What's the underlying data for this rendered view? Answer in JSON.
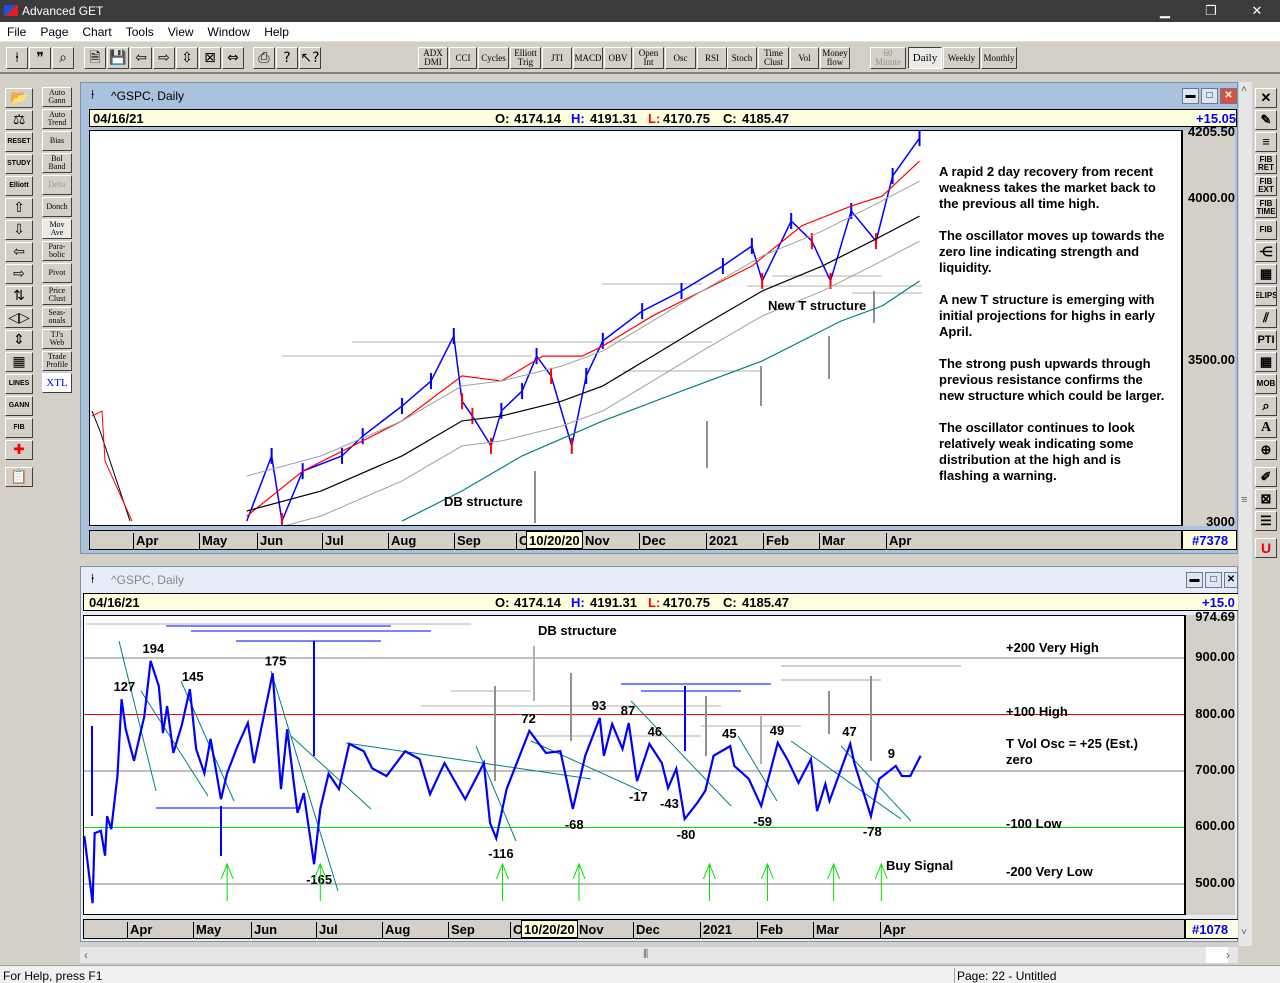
{
  "app": {
    "title": "Advanced GET",
    "minimize": "▁",
    "restore": "❐",
    "close": "✕"
  },
  "menu": [
    "File",
    "Page",
    "Chart",
    "Tools",
    "View",
    "Window",
    "Help"
  ],
  "toolbar": {
    "icons": [
      "cursor-icon",
      "quote-icon",
      "zoom-icon",
      "new-page-icon",
      "save-icon",
      "scroll-left-icon",
      "scroll-right-icon",
      "expand-icon",
      "compress-icon",
      "link-icon",
      "print-icon",
      "help-icon",
      "context-help-icon"
    ],
    "studies": [
      "ADX DMI",
      "CCI",
      "Cycles",
      "Elliott Trig",
      "JTI",
      "MACD",
      "OBV",
      "Open Int",
      "Osc",
      "RSI",
      "Stoch",
      "Time Clust",
      "Vol",
      "Money flow"
    ],
    "timeframes": [
      {
        "label": "60 Minute",
        "state": "disabled"
      },
      {
        "label": "Daily",
        "state": "active"
      },
      {
        "label": "Weekly",
        "state": "normal"
      },
      {
        "label": "Monthly",
        "state": "normal"
      }
    ]
  },
  "left_tools_a": [
    "open",
    "bias-scale",
    "RESET",
    "STUDY",
    "Elliott",
    "up",
    "down",
    "left",
    "right",
    "split",
    "expand",
    "contract",
    "grid",
    "LINES",
    "GANN",
    "FIB",
    "crosshair",
    "notes"
  ],
  "left_tools_b": [
    {
      "label": "Auto Gann"
    },
    {
      "label": "Auto Trend"
    },
    {
      "label": "Bias"
    },
    {
      "label": "Bol Band"
    },
    {
      "label": "Delta",
      "disabled": true
    },
    {
      "label": "Donch"
    },
    {
      "label": "Mov Ave",
      "active": true
    },
    {
      "label": "Para-bolic"
    },
    {
      "label": "Pivot"
    },
    {
      "label": "Price Clust"
    },
    {
      "label": "Seas-onals"
    },
    {
      "label": "TJ's Web"
    },
    {
      "label": "Trade Profile"
    },
    {
      "label": "XTL"
    }
  ],
  "right_tools": [
    "FIB RET",
    "FIB EXT",
    "FIB TIME",
    "FIB",
    "ELIPS",
    "PTI",
    "MOB",
    "A"
  ],
  "chart1": {
    "title": "^GSPC, Daily",
    "date": "04/16/21",
    "o_label": "O:",
    "o": "4174.14",
    "h_label": "H:",
    "h": "4191.31",
    "l_label": "L:",
    "l": "4170.75",
    "c_label": "C:",
    "c": "4185.47",
    "change": "+15.05",
    "bar_count": "#7378",
    "y_top": "4205.50",
    "y_ticks": [
      "4000.00",
      "3500.00",
      "3000"
    ],
    "annotations": {
      "new_t": "New T structure",
      "db": "DB structure"
    },
    "commentary": [
      "A rapid 2 day recovery from recent weakness takes the market back to the previous all time high.",
      "The oscillator moves up towards the zero line indicating strength and liquidity.",
      "A new T structure is emerging with initial projections for highs in early April.",
      "The strong push upwards through previous resistance confirms the new structure which could be larger.",
      "The oscillator continues to look relatively weak indicating some distribution at the high and is flashing a warning."
    ]
  },
  "chart2": {
    "title": "^GSPC, Daily",
    "date": "04/16/21",
    "o_label": "O:",
    "o": "4174.14",
    "h_label": "H:",
    "h": "4191.31",
    "l_label": "L:",
    "l": "4170.75",
    "c_label": "C:",
    "c": "4185.47",
    "change": "+15.0",
    "bar_count": "#1078",
    "y_top": "974.69",
    "y_ticks": [
      "900.00",
      "800.00",
      "700.00",
      "600.00",
      "500.00"
    ],
    "levels": [
      "+200 Very High",
      "+100 High",
      "T Vol Osc = +25 (Est.)",
      "zero",
      "-100 Low",
      "-200 Very Low"
    ],
    "db": "DB structure",
    "buy_signal": "Buy Signal"
  },
  "xaxis": {
    "months": [
      "Apr",
      "May",
      "Jun",
      "Jul",
      "Aug",
      "Sep",
      "O",
      "Nov",
      "Dec",
      "2021",
      "Feb",
      "Mar",
      "Apr"
    ],
    "cursor_date": "10/20/20"
  },
  "status": {
    "help": "For Help, press F1",
    "page": "Page: 22 - Untitled"
  },
  "colors": {
    "osc": "#0000ff",
    "high": "#ff0000",
    "low": "#00e000",
    "ma_fast": "#ff0000",
    "ma_slow": "#000000",
    "band": "#a0a0a0",
    "trend": "#008080"
  },
  "chart_data": [
    {
      "type": "line",
      "title": "^GSPC, Daily",
      "x_unit": "days since 2020-03-01",
      "ylim": [
        2950,
        4205.5
      ],
      "series": [
        {
          "name": "price",
          "x": [
            85,
            97,
            102,
            112,
            131,
            141,
            160,
            174,
            185,
            189,
            194,
            203,
            208,
            218,
            225,
            232,
            242,
            249,
            257,
            276,
            295,
            315,
            329,
            334,
            348,
            358,
            367,
            377,
            389,
            397,
            410
          ],
          "values": [
            3003,
            3204,
            3003,
            3157,
            3204,
            3265,
            3358,
            3435,
            3574,
            3373,
            3327,
            3235,
            3343,
            3404,
            3512,
            3451,
            3235,
            3451,
            3559,
            3651,
            3713,
            3790,
            3852,
            3744,
            3929,
            3867,
            3744,
            3960,
            3867,
            4068,
            4185
          ]
        },
        {
          "name": "ma-red",
          "x": [
            85,
            112,
            160,
            189,
            208,
            228,
            247,
            257,
            281,
            305,
            329,
            353,
            377,
            392,
            410
          ],
          "values": [
            3018,
            3157,
            3312,
            3451,
            3435,
            3512,
            3512,
            3543,
            3636,
            3713,
            3790,
            3914,
            3975,
            4006,
            4114
          ]
        },
        {
          "name": "ma-black",
          "x": [
            85,
            121,
            160,
            189,
            208,
            237,
            257,
            281,
            305,
            334,
            363,
            387,
            410
          ],
          "values": [
            3034,
            3096,
            3204,
            3312,
            3327,
            3373,
            3420,
            3512,
            3605,
            3713,
            3790,
            3867,
            3944
          ]
        },
        {
          "name": "trend-teal",
          "x": [
            160,
            189,
            218,
            257,
            295,
            334,
            372,
            392,
            410
          ],
          "values": [
            3003,
            3096,
            3204,
            3312,
            3404,
            3497,
            3620,
            3667,
            3744
          ]
        }
      ]
    },
    {
      "type": "line",
      "title": "T Vol Osc",
      "x_unit": "days since 2020-03-01",
      "ylim": [
        -240,
        362
      ],
      "levels": [
        200,
        100,
        0,
        -100,
        -200
      ],
      "series": [
        {
          "name": "osc",
          "x": [
            7,
            11,
            12,
            15,
            17,
            18,
            20,
            23,
            25,
            27,
            31,
            36,
            39,
            43,
            45,
            47,
            50,
            54,
            58,
            61,
            65,
            68,
            73,
            76,
            81,
            86,
            89,
            98,
            102,
            105,
            110,
            113,
            118,
            121,
            125,
            130,
            135,
            142,
            146,
            153,
            162,
            169,
            174,
            181,
            191,
            200,
            203,
            206,
            211,
            222,
            230,
            237,
            243,
            249,
            256,
            258,
            262,
            267,
            270,
            274,
            280,
            286,
            289,
            293,
            297,
            303,
            307,
            311,
            319,
            321,
            328,
            334,
            342,
            347,
            352,
            358,
            361,
            365,
            367,
            377,
            379,
            387,
            391,
            399,
            402,
            406,
            411
          ],
          "values": [
            -115,
            -234,
            -110,
            -106,
            -150,
            -80,
            -103,
            -9,
            127,
            74,
            18,
            97,
            195,
            150,
            67,
            115,
            32,
            80,
            145,
            39,
            -4,
            57,
            -50,
            -4,
            44,
            85,
            14,
            173,
            -32,
            74,
            -74,
            -39,
            -165,
            -67,
            -5,
            -32,
            48,
            35,
            5,
            -9,
            35,
            21,
            -41,
            14,
            -50,
            14,
            -92,
            -119,
            -32,
            71,
            32,
            35,
            -67,
            27,
            94,
            27,
            83,
            39,
            85,
            -18,
            48,
            14,
            -30,
            4,
            -85,
            -57,
            -35,
            27,
            44,
            9,
            -14,
            -62,
            50,
            18,
            -21,
            21,
            -71,
            -23,
            -53,
            48,
            14,
            -80,
            -14,
            9,
            -9,
            -9,
            27
          ]
        }
      ],
      "labels": [
        {
          "x": 25,
          "v": 127,
          "t": "127",
          "pos": "above"
        },
        {
          "x": 39,
          "v": 195,
          "t": "194",
          "pos": "above"
        },
        {
          "x": 58,
          "v": 145,
          "t": "145",
          "pos": "above"
        },
        {
          "x": 98,
          "v": 173,
          "t": "175",
          "pos": "above"
        },
        {
          "x": 118,
          "v": -165,
          "t": "-165",
          "pos": "below"
        },
        {
          "x": 206,
          "v": -119,
          "t": "-116",
          "pos": "below"
        },
        {
          "x": 222,
          "v": 71,
          "t": "72",
          "pos": "above"
        },
        {
          "x": 243,
          "v": -67,
          "t": "-68",
          "pos": "below"
        },
        {
          "x": 256,
          "v": 94,
          "t": "93",
          "pos": "above"
        },
        {
          "x": 270,
          "v": 85,
          "t": "87",
          "pos": "above"
        },
        {
          "x": 283,
          "v": 48,
          "t": "46",
          "pos": "above"
        },
        {
          "x": 274,
          "v": -18,
          "t": "-17",
          "pos": "below"
        },
        {
          "x": 289,
          "v": -30,
          "t": "-43",
          "pos": "below"
        },
        {
          "x": 297,
          "v": -85,
          "t": "-80",
          "pos": "below"
        },
        {
          "x": 319,
          "v": 44,
          "t": "45",
          "pos": "above"
        },
        {
          "x": 334,
          "v": -62,
          "t": "-59",
          "pos": "below"
        },
        {
          "x": 342,
          "v": 50,
          "t": "49",
          "pos": "above"
        },
        {
          "x": 377,
          "v": 48,
          "t": "47",
          "pos": "above"
        },
        {
          "x": 387,
          "v": -80,
          "t": "-78",
          "pos": "below"
        },
        {
          "x": 399,
          "v": 9,
          "t": "9",
          "pos": "above"
        }
      ],
      "buy_signals": [
        76,
        121,
        209,
        246,
        309,
        337,
        369,
        392
      ]
    }
  ]
}
